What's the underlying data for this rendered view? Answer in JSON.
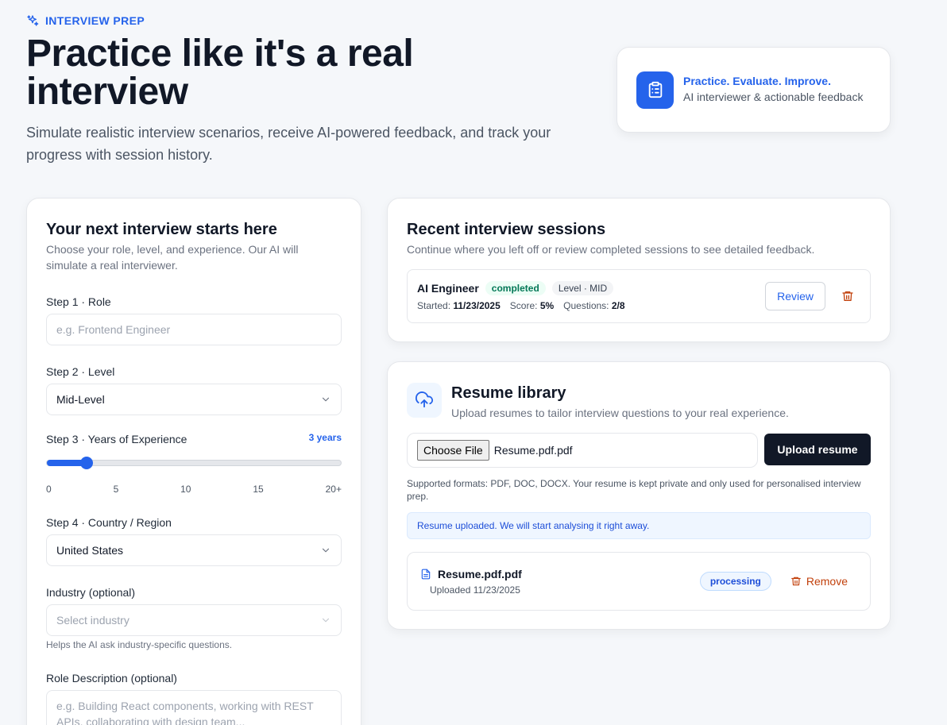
{
  "header": {
    "eyebrow": "INTERVIEW PREP",
    "title": "Practice like it's a real interview",
    "subtitle": "Simulate realistic interview scenarios, receive AI-powered feedback, and track your progress with session history."
  },
  "promo": {
    "title": "Practice. Evaluate. Improve.",
    "text": "AI interviewer & actionable feedback"
  },
  "setup": {
    "title": "Your next interview starts here",
    "desc": "Choose your role, level, and experience. Our AI will simulate a real interviewer.",
    "role_label": "Step 1 · Role",
    "role_placeholder": "e.g. Frontend Engineer",
    "level_label": "Step 2 · Level",
    "level_value": "Mid-Level",
    "years_label": "Step 3 · Years of Experience",
    "years_value": "3 years",
    "years_fraction": 0.135,
    "ticks": [
      "0",
      "5",
      "10",
      "15",
      "20+"
    ],
    "country_label": "Step 4 · Country / Region",
    "country_value": "United States",
    "industry_label": "Industry (optional)",
    "industry_placeholder": "Select industry",
    "industry_helper": "Helps the AI ask industry-specific questions.",
    "desc_label": "Role Description (optional)",
    "desc_placeholder": "e.g. Building React components, working with REST APIs, collaborating with design team..."
  },
  "sessions": {
    "title": "Recent interview sessions",
    "desc": "Continue where you left off or review completed sessions to see detailed feedback.",
    "items": [
      {
        "role": "AI Engineer",
        "status": "completed",
        "level": "Level · MID",
        "started_label": "Started:",
        "started": "11/23/2025",
        "score_label": "Score:",
        "score": "5%",
        "questions_label": "Questions:",
        "questions": "2/8",
        "review_label": "Review"
      }
    ]
  },
  "resume": {
    "title": "Resume library",
    "desc": "Upload resumes to tailor interview questions to your real experience.",
    "choose_label": "Choose File",
    "chosen_file": "Resume.pdf.pdf",
    "upload_label": "Upload resume",
    "supported": "Supported formats: PDF, DOC, DOCX. Your resume is kept private and only used for personalised interview prep.",
    "alert": "Resume uploaded. We will start analysing it right away.",
    "files": [
      {
        "name": "Resume.pdf.pdf",
        "uploaded": "Uploaded 11/23/2025",
        "status": "processing",
        "remove_label": "Remove"
      }
    ]
  },
  "colors": {
    "accent": "#2563eb",
    "dark": "#111827",
    "danger": "#c2410c",
    "success": "#047857"
  }
}
